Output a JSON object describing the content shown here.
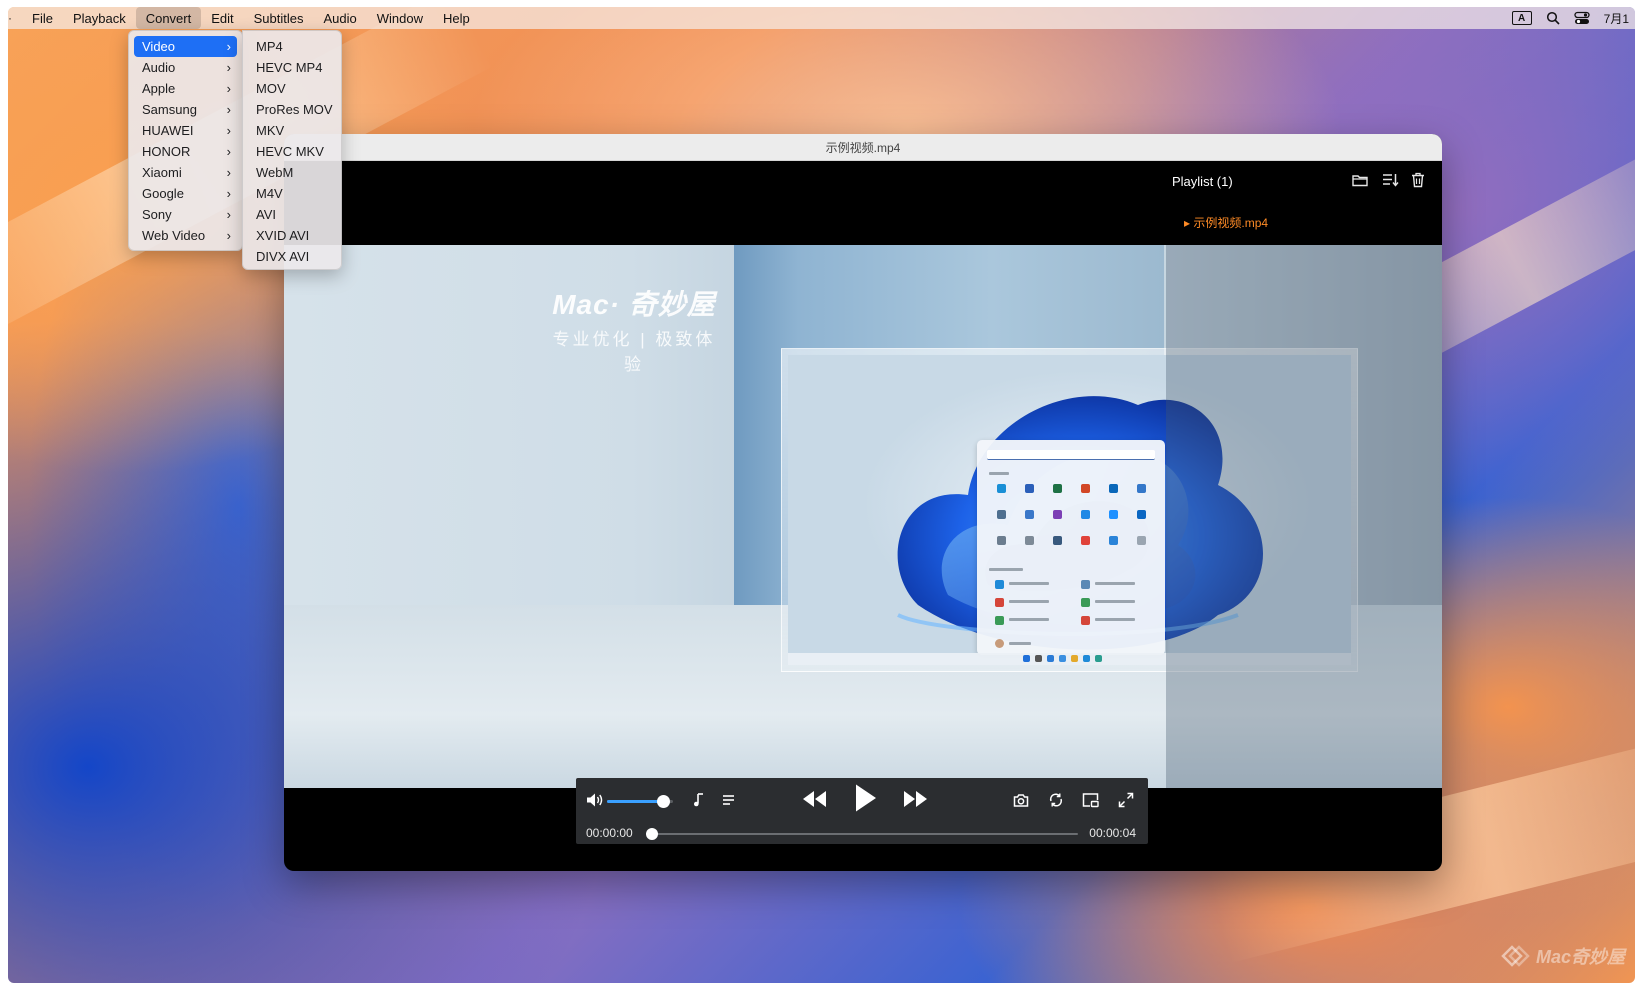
{
  "menubar": {
    "apple_glyph": "·",
    "items": [
      "File",
      "Playback",
      "Convert",
      "Edit",
      "Subtitles",
      "Audio",
      "Window",
      "Help"
    ],
    "active_index": 2,
    "status": {
      "input_badge": "A",
      "date": "7月1"
    }
  },
  "convert_menu": {
    "items": [
      "Video",
      "Audio",
      "Apple",
      "Samsung",
      "HUAWEI",
      "HONOR",
      "Xiaomi",
      "Google",
      "Sony",
      "Web Video"
    ],
    "selected": "Video"
  },
  "video_submenu": {
    "items": [
      "MP4",
      "HEVC MP4",
      "MOV",
      "ProRes MOV",
      "MKV",
      "HEVC MKV",
      "WebM",
      "M4V",
      "AVI",
      "XVID AVI",
      "DIVX AVI"
    ]
  },
  "window": {
    "title": "示例视频.mp4",
    "playlist": {
      "title": "Playlist (1)",
      "items": [
        "示例视频.mp4"
      ]
    },
    "video_overlay": {
      "logo": "Mac· 奇妙屋",
      "tagline": "专业优化 | 极致体验"
    }
  },
  "controls": {
    "time_current": "00:00:00",
    "time_duration": "00:00:04",
    "volume_level": 0.85,
    "seek_progress": 0.0
  },
  "watermark": "Mac奇妙屋",
  "colors": {
    "accent": "#1e6ff5",
    "playlist_active": "#ff8b26",
    "volume_fill": "#3aa0ff",
    "control_bar": "#2b2d30"
  }
}
